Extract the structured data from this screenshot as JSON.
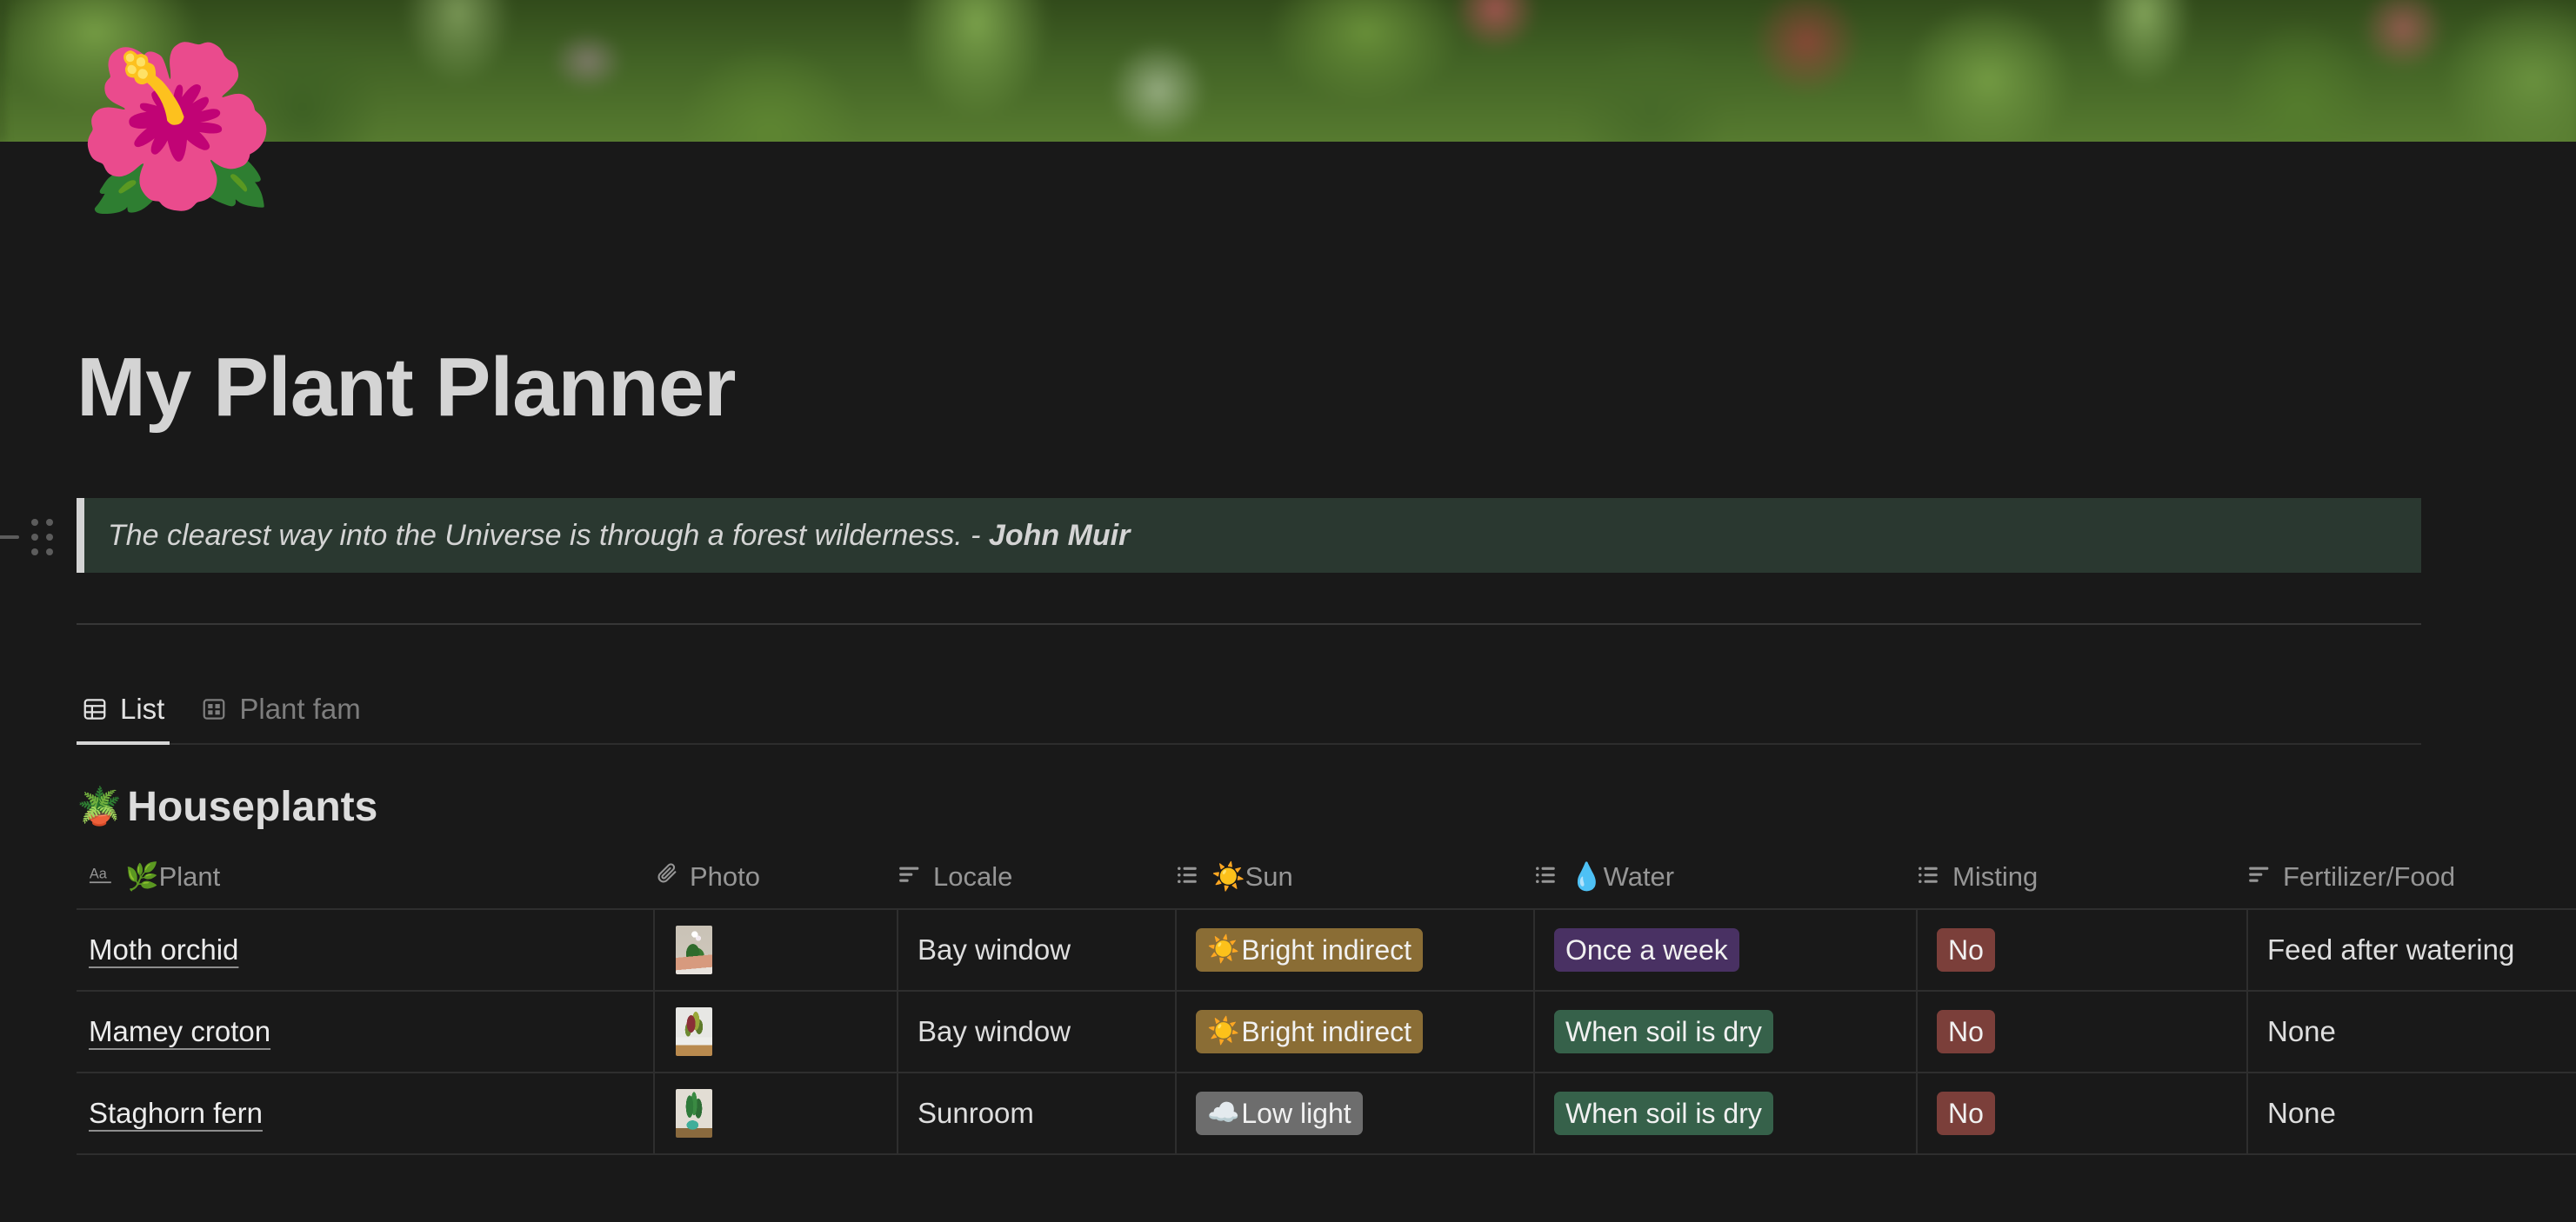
{
  "cover": {
    "icon": "🌺",
    "icon_name": "hibiscus-page-icon"
  },
  "page": {
    "title": "My Plant Planner"
  },
  "quote": {
    "text": "The clearest way into the Universe is through a forest wilderness. - ",
    "author": "John Muir"
  },
  "tabs": [
    {
      "label": "List",
      "icon": "table-icon",
      "active": true
    },
    {
      "label": "Plant fam",
      "icon": "gallery-icon",
      "active": false
    }
  ],
  "section": {
    "emoji": "🪴",
    "title": "Houseplants"
  },
  "table": {
    "columns": [
      {
        "label": "🌿Plant",
        "icon": "title-text-icon"
      },
      {
        "label": "Photo",
        "icon": "paperclip-icon"
      },
      {
        "label": "Locale",
        "icon": "text-lines-icon"
      },
      {
        "label": "☀️Sun",
        "icon": "select-list-icon"
      },
      {
        "label": "💧Water",
        "icon": "select-list-icon"
      },
      {
        "label": "Misting",
        "icon": "select-list-icon"
      },
      {
        "label": "Fertilizer/Food",
        "icon": "text-lines-icon"
      }
    ],
    "rows": [
      {
        "plant": "Moth orchid",
        "photo": "orchid-thumbnail",
        "locale": "Bay window",
        "sun": {
          "emoji": "☀️",
          "label": "Bright indirect",
          "color": "#8a6d35"
        },
        "water": {
          "label": "Once a week",
          "color": "#493163"
        },
        "misting": {
          "label": "No",
          "color": "#7b3f3a"
        },
        "fertilizer": "Feed after watering"
      },
      {
        "plant": "Mamey croton",
        "photo": "croton-thumbnail",
        "locale": "Bay window",
        "sun": {
          "emoji": "☀️",
          "label": "Bright indirect",
          "color": "#8a6d35"
        },
        "water": {
          "label": "When soil is dry",
          "color": "#36614a"
        },
        "misting": {
          "label": "No",
          "color": "#7b3f3a"
        },
        "fertilizer": "None"
      },
      {
        "plant": "Staghorn fern",
        "photo": "fern-thumbnail",
        "locale": "Sunroom",
        "sun": {
          "emoji": "☁️",
          "label": "Low light",
          "color": "#6d6d6d"
        },
        "water": {
          "label": "When soil is dry",
          "color": "#36614a"
        },
        "misting": {
          "label": "No",
          "color": "#7b3f3a"
        },
        "fertilizer": "None"
      }
    ]
  }
}
